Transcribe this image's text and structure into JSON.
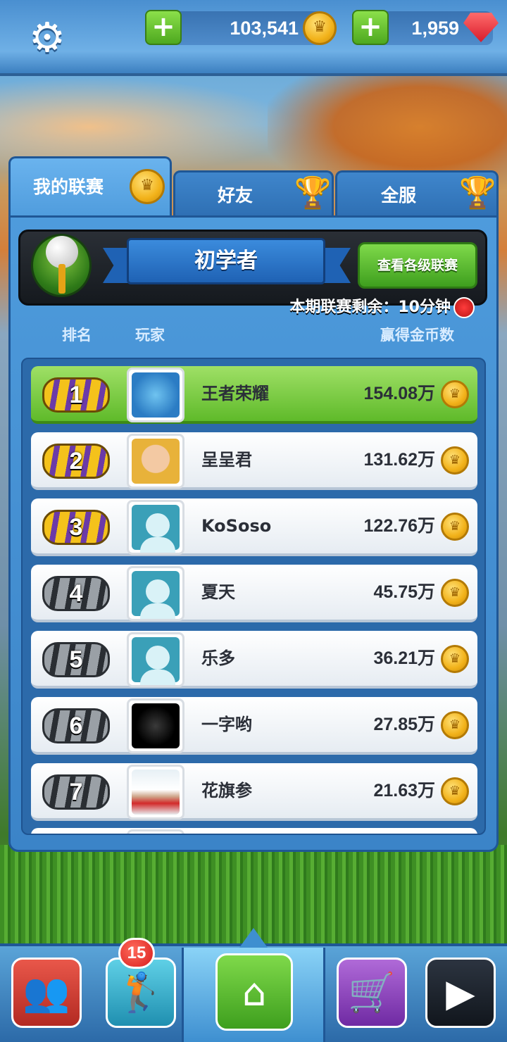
{
  "resources": {
    "coins": "103,541",
    "gems": "1,959"
  },
  "tabs": [
    {
      "label": "我的联赛"
    },
    {
      "label": "好友"
    },
    {
      "label": "全服"
    }
  ],
  "league": {
    "tier": "初学者",
    "view_button": "查看各级联赛",
    "countdown": "本期联赛剩余：10分钟"
  },
  "columns": {
    "rank": "排名",
    "player": "玩家",
    "coins_won": "赢得金币数"
  },
  "players": [
    {
      "rank": "1",
      "name": "王者荣耀",
      "score": "154.08万"
    },
    {
      "rank": "2",
      "name": "呈呈君",
      "score": "131.62万"
    },
    {
      "rank": "3",
      "name": "KoSoso",
      "score": "122.76万"
    },
    {
      "rank": "4",
      "name": "夏天",
      "score": "45.75万"
    },
    {
      "rank": "5",
      "name": "乐多",
      "score": "36.21万"
    },
    {
      "rank": "6",
      "name": "一字哟",
      "score": "27.85万"
    },
    {
      "rank": "7",
      "name": "花旗参",
      "score": "21.63万"
    }
  ],
  "bottom_nav": {
    "clubs_badge": "15"
  },
  "icons": {
    "settings": "gear-icon",
    "coin": "crown-coin-icon",
    "gem": "ruby-gem-icon",
    "trophy": "trophy-icon",
    "clock": "timer-icon",
    "nav": [
      "teams-icon",
      "golf-bag-icon",
      "home-icon",
      "shop-cart-icon",
      "video-replay-icon"
    ]
  },
  "colors": {
    "panel_blue": "#3b84c8",
    "first_row_green": "#5fba2a",
    "coin_gold": "#f2b21a",
    "gem_red": "#d81b2b"
  }
}
